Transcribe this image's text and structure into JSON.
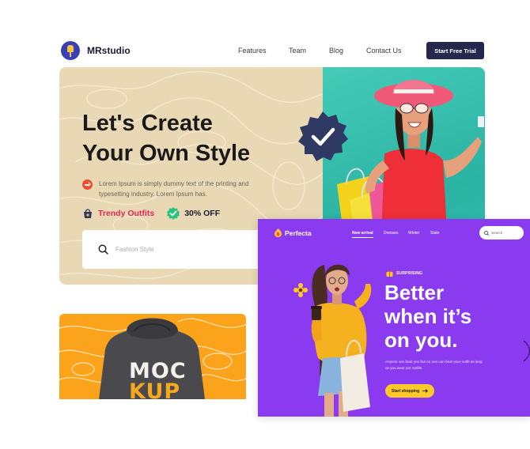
{
  "header": {
    "brand": "MRstudio",
    "nav": [
      "Features",
      "Team",
      "Blog",
      "Contact Us"
    ],
    "cta_label": "Start Free Trial"
  },
  "hero": {
    "title_line1": "Let's Create",
    "title_line2": "Your Own Style",
    "description": "Lorem Ipsum is simply dummy text of the printing and typesetting industry. Lorem Ipsum has.",
    "tag_trendy": "Trendy Outfits",
    "tag_off": "30% OFF",
    "search_placeholder": "Fashion Style"
  },
  "mockup": {
    "line1": "MOC",
    "line2": "KUP"
  },
  "perfecta": {
    "brand": "Perfecta",
    "nav": [
      "New arrival",
      "Dresses",
      "Winter",
      "Slate"
    ],
    "search_placeholder": "Search",
    "kicker": "SURPRISING",
    "headline_line1": "Better",
    "headline_line2": "when it’s",
    "headline_line3": "on you.",
    "description": "Anyone can beat you but no one can beat your outfit as long as you wear por outfits.",
    "button_label": "Start shopping"
  },
  "colors": {
    "hero_beige": "#e8d8b4",
    "hero_teal": "#33bfb0",
    "cta_navy": "#24284d",
    "accent_pink": "#e0285a",
    "badge_navy": "#2e3a63",
    "perfecta_purple": "#8a3bf0",
    "perfecta_yellow": "#ffc928",
    "mockup_orange": "#fba41b"
  }
}
